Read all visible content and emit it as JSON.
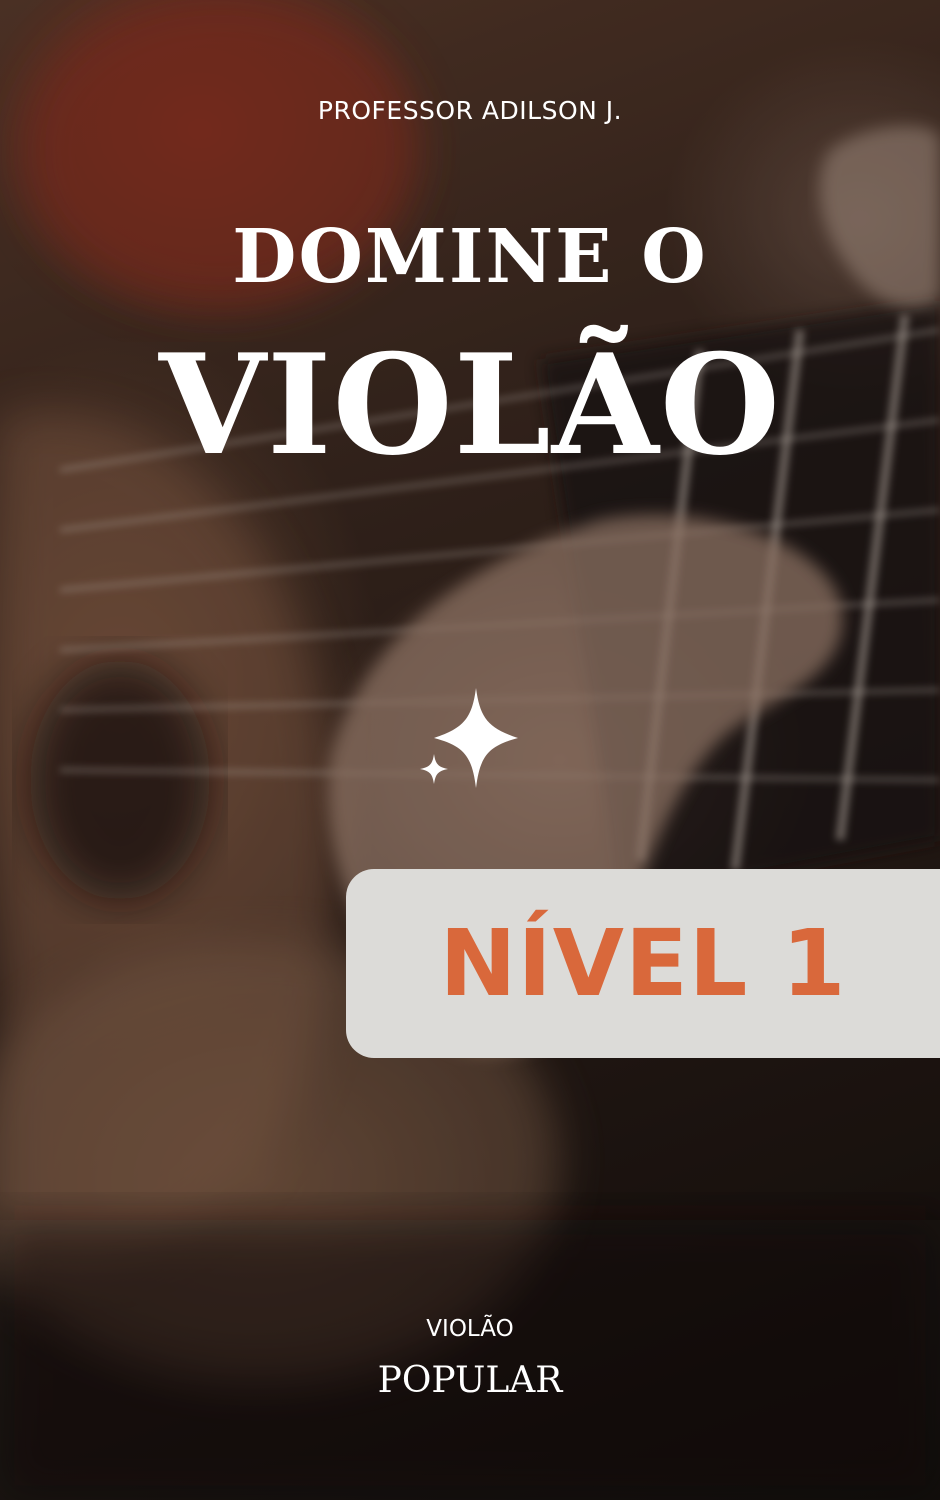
{
  "cover": {
    "author": "PROFESSOR ADILSON J.",
    "title_line_1": "DOMINE O",
    "title_line_2": "VIOLÃO",
    "level": "NÍVEL 1",
    "genre_line_1": "VIOLÃO",
    "genre_line_2": "POPULAR"
  },
  "colors": {
    "level_text": "#d9683b",
    "level_box": "#dcdbd8",
    "text": "#ffffff"
  },
  "icons": {
    "sparkle": "sparkle-icon"
  }
}
